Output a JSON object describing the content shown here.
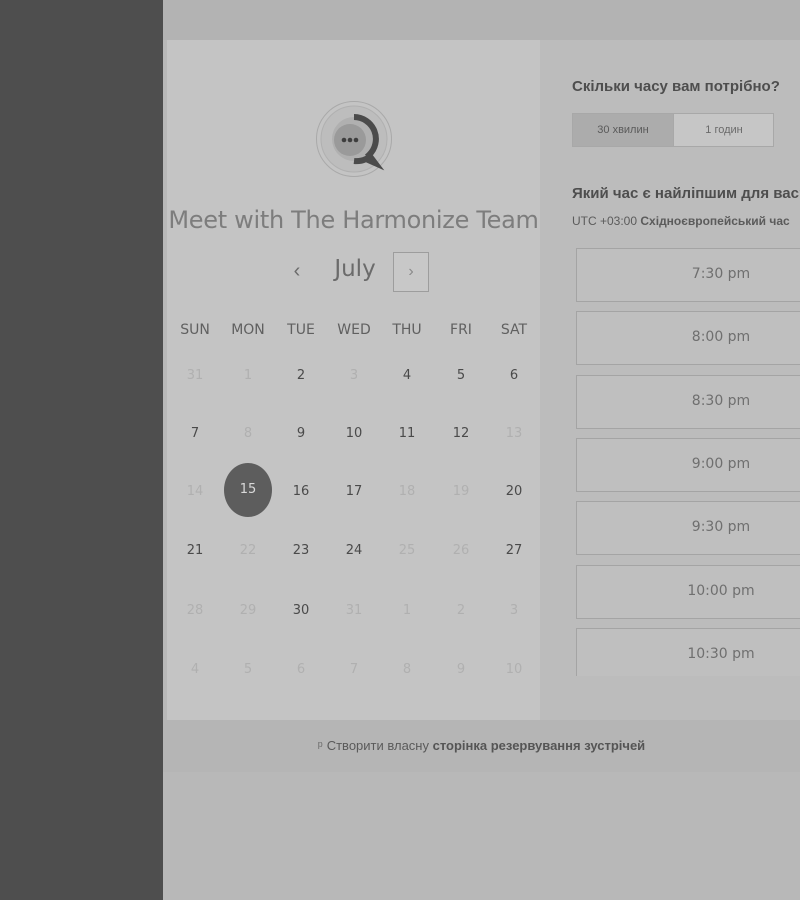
{
  "calendar": {
    "title": "Meet with The Harmonize Team",
    "month": "July",
    "prev_label": "‹",
    "next_label": "›",
    "weekdays": [
      "SUN",
      "MON",
      "TUE",
      "WED",
      "THU",
      "FRI",
      "SAT"
    ],
    "days": [
      [
        "31",
        "1",
        "2",
        "3",
        "4",
        "5",
        "6"
      ],
      [
        "7",
        "8",
        "9",
        "10",
        "11",
        "12",
        "13"
      ],
      [
        "14",
        "15",
        "16",
        "17",
        "18",
        "19",
        "20"
      ],
      [
        "21",
        "22",
        "23",
        "24",
        "25",
        "26",
        "27"
      ],
      [
        "28",
        "29",
        "30",
        "31",
        "1",
        "2",
        "3"
      ],
      [
        "4",
        "5",
        "6",
        "7",
        "8",
        "9",
        "10"
      ]
    ],
    "selected_day": "15"
  },
  "booking": {
    "duration_question": "Скільки часу вам потрібно?",
    "duration_options": [
      "30 хвилин",
      "1 годин"
    ],
    "selected_duration": "30 хвилин",
    "time_question": "Який час є найліпшим для вас?",
    "timezone_offset": "UTC +03:00",
    "timezone_name": "Східноєвропейський час",
    "slots": [
      "7:30 pm",
      "8:00 pm",
      "8:30 pm",
      "9:00 pm",
      "9:30 pm",
      "10:00 pm",
      "10:30 pm"
    ]
  },
  "footer": {
    "prefix": "Створити власну",
    "link": "сторінка резервування зустрічей"
  },
  "colors": {
    "sidebar": "#4e4e4e",
    "selected_day": "#5d5d5d",
    "panel": "#c4c4c4"
  }
}
